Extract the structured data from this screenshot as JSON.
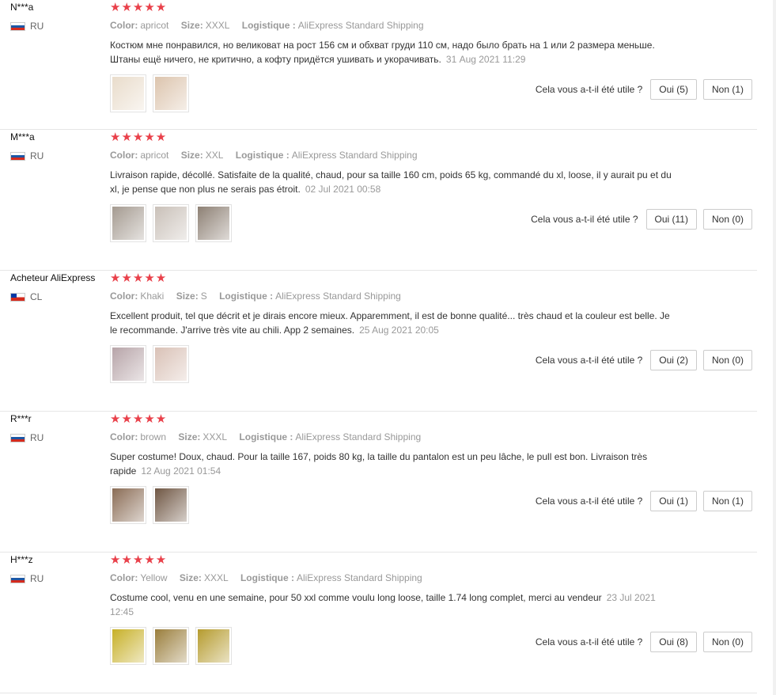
{
  "helpful_question": "Cela vous a-t-il été utile ?",
  "labels": {
    "color": "Color:",
    "size": "Size:",
    "shipping": "Logistique :"
  },
  "stars": "★★★★★",
  "reviews": [
    {
      "user": "N***a",
      "country": "RU",
      "flag": "ru",
      "color": "apricot",
      "size": "XXXL",
      "shipping": "AliExpress Standard Shipping",
      "text": "Костюм мне понравился, но великоват на рост 156 см и обхват груди 110 см, надо было брать на 1 или 2 размера меньше. Штаны ещё ничего, не критично, а кофту придётся ушивать и укорачивать.",
      "date": "31 Aug 2021 11:29",
      "yes": "Oui (5)",
      "no": "Non (1)",
      "photos": [
        "#e9dccb",
        "#dcc4ad"
      ]
    },
    {
      "user": "M***a",
      "country": "RU",
      "flag": "ru",
      "color": "apricot",
      "size": "XXL",
      "shipping": "AliExpress Standard Shipping",
      "text": "Livraison rapide, décollé. Satisfaite de la qualité, chaud, pour sa taille 160 cm, poids 65 kg, commandé du xl, loose, il y aurait pu et du xl, je pense que non plus ne serais pas étroit.",
      "date": "02 Jul 2021 00:58",
      "yes": "Oui (11)",
      "no": "Non (0)",
      "photos": [
        "#a49a90",
        "#c9c0b8",
        "#8d8074"
      ]
    },
    {
      "user": "Acheteur AliExpress",
      "country": "CL",
      "flag": "cl",
      "color": "Khaki",
      "size": "S",
      "shipping": "AliExpress Standard Shipping",
      "text": "Excellent produit, tel que décrit et je dirais encore mieux. Apparemment, il est de bonne qualité... très chaud et la couleur est belle. Je le recommande. J'arrive très vite au chili. App 2 semaines.",
      "date": "25 Aug 2021 20:05",
      "yes": "Oui (2)",
      "no": "Non (0)",
      "photos": [
        "#b7a4a8",
        "#d9c1b6"
      ]
    },
    {
      "user": "R***r",
      "country": "RU",
      "flag": "ru",
      "color": "brown",
      "size": "XXXL",
      "shipping": "AliExpress Standard Shipping",
      "text": "Super costume! Doux, chaud. Pour la taille 167, poids 80 kg, la taille du pantalon est un peu lâche, le pull est bon. Livraison très rapide",
      "date": "12 Aug 2021 01:54",
      "yes": "Oui (1)",
      "no": "Non (1)",
      "photos": [
        "#8a6c55",
        "#6f5643"
      ]
    },
    {
      "user": "H***z",
      "country": "RU",
      "flag": "ru",
      "color": "Yellow",
      "size": "XXXL",
      "shipping": "AliExpress Standard Shipping",
      "text": "Costume cool, venu en une semaine, pour 50 xxl comme voulu long loose, taille 1.74 long complet, merci au vendeur",
      "date": "23 Jul 2021 12:45",
      "yes": "Oui (8)",
      "no": "Non (0)",
      "photos": [
        "#c7b028",
        "#9a7e3c",
        "#b59b2e"
      ]
    }
  ]
}
